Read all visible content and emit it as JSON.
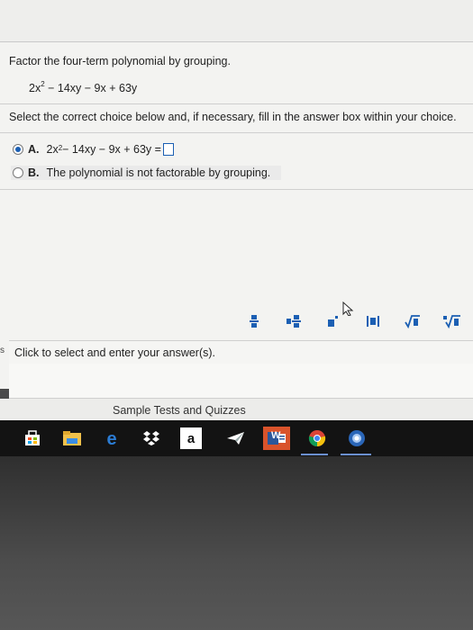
{
  "question": {
    "prompt": "Factor the four-term polynomial by grouping.",
    "polynomial_prefix": "2x",
    "polynomial_exp": "2",
    "polynomial_rest": " − 14xy − 9x + 63y"
  },
  "instruction": "Select the correct choice below and, if necessary, fill in the answer box within your choice.",
  "choices": [
    {
      "letter": "A.",
      "expr_prefix": "2x",
      "expr_exp": "2",
      "expr_rest": " − 14xy − 9x + 63y =",
      "selected": true
    },
    {
      "letter": "B.",
      "text": "The polynomial is not factorable by grouping.",
      "selected": false
    }
  ],
  "toolbar": {
    "icons": [
      "fraction-icon",
      "mixed-number-icon",
      "exponent-icon",
      "absolute-value-icon",
      "square-root-icon",
      "nth-root-icon"
    ],
    "accent_color": "#1b5fb3"
  },
  "hint": "Click to select and enter your answer(s).",
  "left_edge_label": "s",
  "tab_label": "Sample Tests and Quizzes",
  "taskbar": {
    "icons": [
      "store-icon",
      "file-explorer-icon",
      "edge-icon",
      "dropbox-icon",
      "amazon-icon",
      "send-icon",
      "word-icon",
      "chrome-icon",
      "app-icon"
    ],
    "amazon_glyph": "a",
    "word_glyph": "W"
  }
}
